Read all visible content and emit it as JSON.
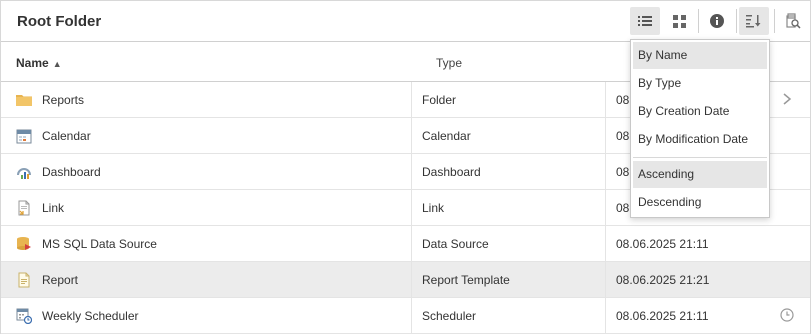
{
  "header": {
    "title": "Root Folder"
  },
  "columns": {
    "name": "Name",
    "type": "Type"
  },
  "rows": [
    {
      "name": "Reports",
      "type": "Folder",
      "date": "08",
      "icon": "folder-icon",
      "trail": "chevron-right-icon"
    },
    {
      "name": "Calendar",
      "type": "Calendar",
      "date": "08",
      "icon": "calendar-icon"
    },
    {
      "name": "Dashboard",
      "type": "Dashboard",
      "date": "08",
      "icon": "dashboard-icon"
    },
    {
      "name": "Link",
      "type": "Link",
      "date": "08",
      "icon": "link-icon"
    },
    {
      "name": "MS SQL Data Source",
      "type": "Data Source",
      "date": "08.06.2025 21:11",
      "icon": "database-icon"
    },
    {
      "name": "Report",
      "type": "Report Template",
      "date": "08.06.2025 21:21",
      "icon": "report-icon",
      "selected": true
    },
    {
      "name": "Weekly Scheduler",
      "type": "Scheduler",
      "date": "08.06.2025 21:11",
      "icon": "scheduler-icon",
      "trail": "clock-icon"
    }
  ],
  "sort_menu": {
    "fields": [
      "By Name",
      "By Type",
      "By Creation Date",
      "By Modification Date"
    ],
    "orders": [
      "Ascending",
      "Descending"
    ],
    "selected_field": "By Name",
    "selected_order": "Ascending"
  },
  "colors": {
    "selected_row": "#ececec",
    "menu_highlight": "#e6e6e6",
    "folder": "#e8b450"
  }
}
